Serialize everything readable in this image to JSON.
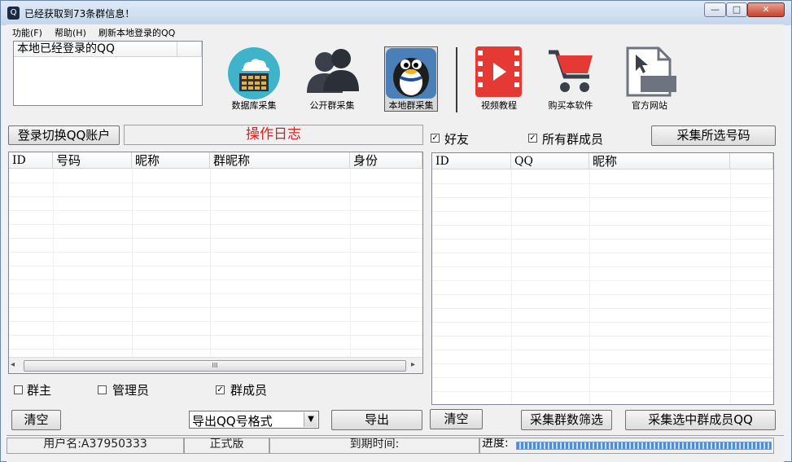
{
  "window": {
    "title": "已经获取到73条群信息！",
    "icon_glyph": "Q"
  },
  "menu": [
    "功能(F)",
    "帮助(H)",
    "刷新本地登录的QQ"
  ],
  "local_qq": {
    "header": "本地已经登录的QQ"
  },
  "toolbar": [
    {
      "label": "数据库采集",
      "icon": "cloud-database-icon"
    },
    {
      "label": "公开群采集",
      "icon": "people-icon"
    },
    {
      "label": "本地群采集",
      "icon": "qq-penguin-icon",
      "selected": true
    },
    {
      "label": "视频教程",
      "icon": "video-film-icon"
    },
    {
      "label": "购买本软件",
      "icon": "shopping-cart-icon"
    },
    {
      "label": "官方网站",
      "icon": "url-file-icon"
    }
  ],
  "left": {
    "switch_button": "登录切换QQ账户",
    "log_label": "操作日志",
    "columns": [
      "ID",
      "号码",
      "昵称",
      "群昵称",
      "身份"
    ],
    "checkboxes": [
      {
        "label": "群主",
        "checked": false
      },
      {
        "label": "管理员",
        "checked": false
      },
      {
        "label": "群成员",
        "checked": true
      }
    ],
    "clear_button": "清空",
    "export_format": "导出QQ号格式",
    "export_button": "导出",
    "scroll_thumb_glyph": "III",
    "scroll_left_glyph": "◂",
    "scroll_right_glyph": "▸"
  },
  "right": {
    "checkboxes": [
      {
        "label": "好友",
        "checked": true
      },
      {
        "label": "所有群成员",
        "checked": true
      }
    ],
    "collect_selected_button": "采集所选号码",
    "columns": [
      "ID",
      "QQ",
      "昵称"
    ],
    "clear_button": "清空",
    "filter_button": "采集群数筛选",
    "collect_members_button": "采集选中群成员QQ"
  },
  "status": {
    "user": "用户名:A37950333",
    "edition": "正式版",
    "expiry": "到期时间:",
    "progress_label": "进度:"
  },
  "colors": {
    "log_text": "#e02020",
    "title_bg": "#c4d6ec",
    "progress": "#4a8fd8"
  }
}
